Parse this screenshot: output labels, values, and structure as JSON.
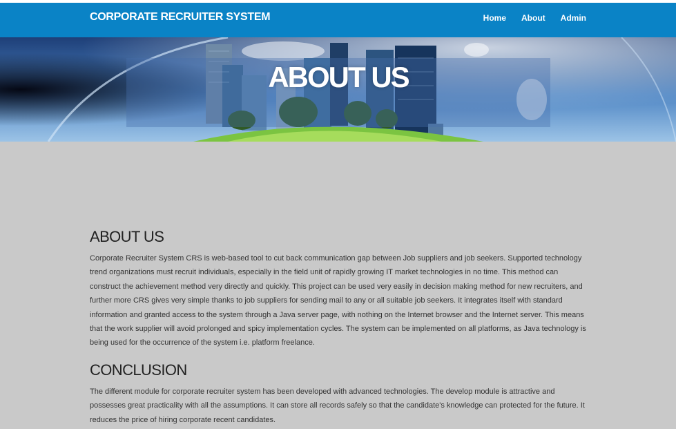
{
  "brand": {
    "name": "CORPORATE RECRUITER SYSTEM"
  },
  "nav": {
    "items": [
      {
        "label": "Home"
      },
      {
        "label": "About"
      },
      {
        "label": "Admin"
      }
    ]
  },
  "banner": {
    "title": "ABOUT US"
  },
  "sections": [
    {
      "heading": "ABOUT US",
      "body": "Corporate Recruiter System CRS is web-based tool to cut back communication gap between Job suppliers and job seekers. Supported technology trend organizations must recruit individuals, especially in the field unit of rapidly growing IT market technologies in no time. This method can construct the achievement method very directly and quickly. This project can be used very easily in decision making method for new recruiters, and further more CRS gives very simple thanks to job suppliers for sending mail to any or all suitable job seekers. It integrates itself with standard information and granted access to the system through a Java server page, with nothing on the Internet browser and the Internet server. This means that the work supplier will avoid prolonged and spicy implementation cycles. The system can be implemented on all platforms, as Java technology is being used for the occurrence of the system i.e. platform freelance."
    },
    {
      "heading": "CONCLUSION",
      "body": "The different module for corporate recruiter system has been developed with advanced technologies. The develop module is attractive and possesses great practicality with all the assumptions. It can store all records safely so that the candidate's knowledge can protected for the future. It reduces the price of hiring corporate recent candidates."
    }
  ],
  "colors": {
    "navbar": "#0a83c6",
    "page_background": "#c9c9c9",
    "text": "#333333"
  }
}
